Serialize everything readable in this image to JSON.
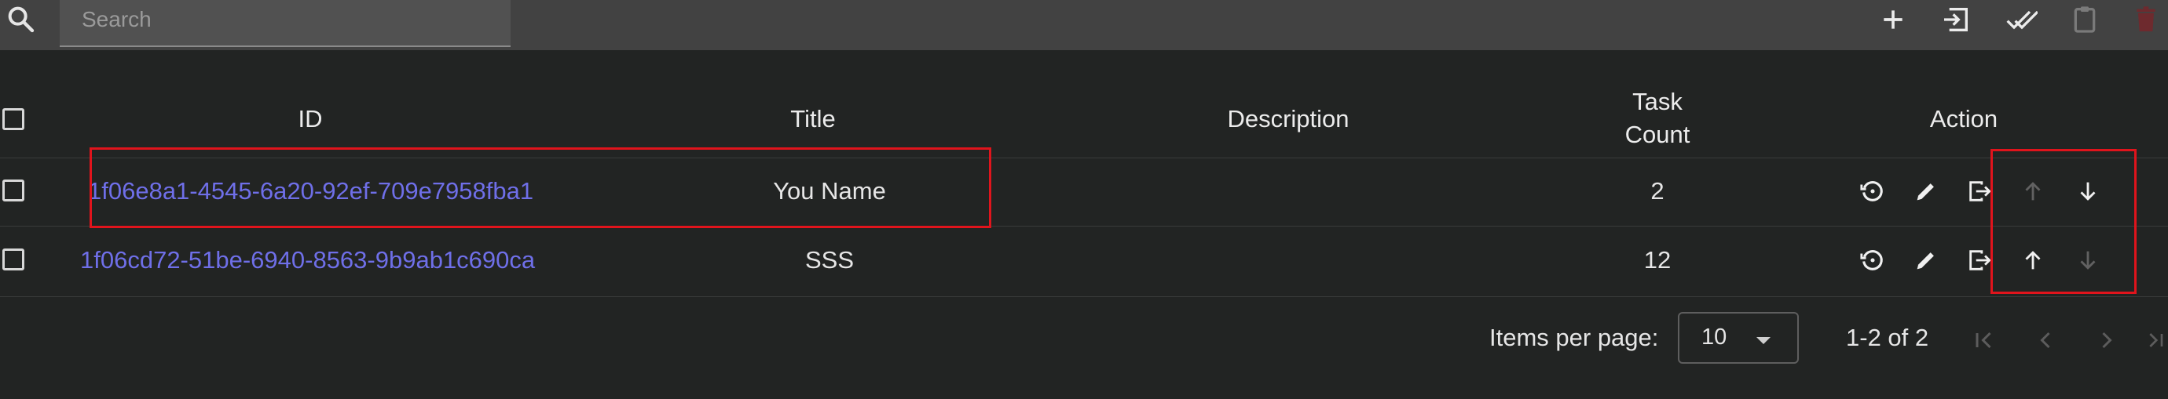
{
  "toolbar": {
    "search_placeholder": "Search",
    "icons": [
      "search-icon",
      "add-icon",
      "import-icon",
      "done-all-icon",
      "clipboard-icon",
      "delete-icon"
    ]
  },
  "table": {
    "headers": {
      "id": "ID",
      "title": "Title",
      "description": "Description",
      "task_count_line1": "Task",
      "task_count_line2": "Count",
      "action": "Action"
    },
    "rows": [
      {
        "id": "1f06e8a1-4545-6a20-92ef-709e7958fba1",
        "title": "You Name",
        "description": "",
        "task_count": "2",
        "move_up_enabled": false,
        "move_down_enabled": true
      },
      {
        "id": "1f06cd72-51be-6940-8563-9b9ab1c690ca",
        "title": "SSS",
        "description": "",
        "task_count": "12",
        "move_up_enabled": true,
        "move_down_enabled": false
      }
    ]
  },
  "paginator": {
    "items_per_page_label": "Items per page:",
    "page_size": "10",
    "range_label": "1-2 of 2"
  },
  "colors": {
    "background": "#222423",
    "toolbar": "#424242",
    "link": "#6f6fe8",
    "highlight": "#e0141c"
  }
}
